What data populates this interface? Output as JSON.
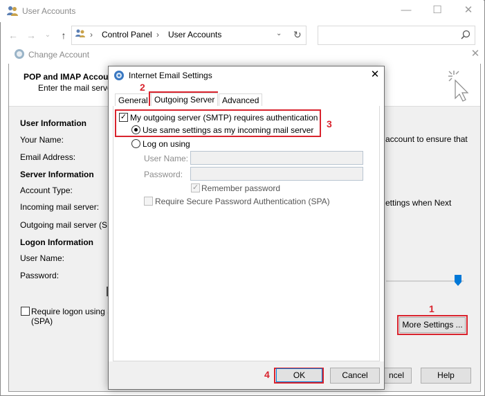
{
  "user_accounts_window": {
    "title": "User Accounts",
    "breadcrumb": [
      "Control Panel",
      "User Accounts"
    ],
    "controls": [
      "—",
      "☐",
      "✕"
    ]
  },
  "change_account": {
    "title": "Change Account",
    "header_title": "POP and IMAP Accoun",
    "header_subtitle": "Enter the mail server",
    "sections": {
      "user_info": "User Information",
      "your_name": "Your Name:",
      "email": "Email Address:",
      "server_info": "Server Information",
      "account_type": "Account Type:",
      "incoming": "Incoming mail server:",
      "outgoing": "Outgoing mail server (SM",
      "logon_info": "Logon Information",
      "user_name": "User Name:",
      "password": "Password:"
    },
    "right_text_1": "account to ensure that",
    "right_text_2": "ettings when Next",
    "require_logon": "Require logon using S",
    "require_logon_2": "(SPA)",
    "more_settings": "More Settings ...",
    "cancel_partial": "ncel",
    "help": "Help"
  },
  "internet_email_settings": {
    "title": "Internet Email Settings",
    "close": "✕",
    "tabs": [
      "General",
      "Outgoing Server",
      "Advanced"
    ],
    "smtp_auth": "My outgoing server (SMTP) requires authentication",
    "use_same": "Use same settings as my incoming mail server",
    "log_on_using": "Log on using",
    "user_name_label": "User Name:",
    "password_label": "Password:",
    "remember_password": "Remember password",
    "require_spa": "Require Secure Password Authentication (SPA)",
    "ok": "OK",
    "cancel": "Cancel"
  },
  "annotations": {
    "step1": "1",
    "step2": "2",
    "step3": "3",
    "step4": "4",
    "color": "#d9232d"
  }
}
